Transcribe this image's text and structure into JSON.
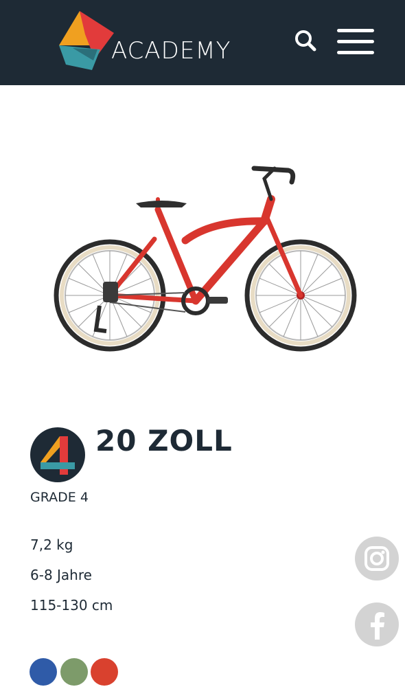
{
  "header": {
    "brand": "ACADEMY",
    "search_icon": "search-icon",
    "menu_icon": "hamburger-menu-icon",
    "background": "#1e2a35"
  },
  "product": {
    "title": "20 ZOLL",
    "badge_digit": "4",
    "grade": "GRADE 4",
    "specs": {
      "weight": "7,2 kg",
      "age": "6-8 Jahre",
      "height": "115-130 cm"
    },
    "colors": [
      "#2f5ba8",
      "#7d9b6a",
      "#d9412e"
    ]
  },
  "social": {
    "items": [
      {
        "icon": "instagram-icon"
      },
      {
        "icon": "facebook-icon"
      }
    ]
  },
  "brand_colors": {
    "orange": "#f0a020",
    "red": "#e23b3b",
    "teal": "#3a9aa5",
    "dark": "#1e2a35"
  }
}
